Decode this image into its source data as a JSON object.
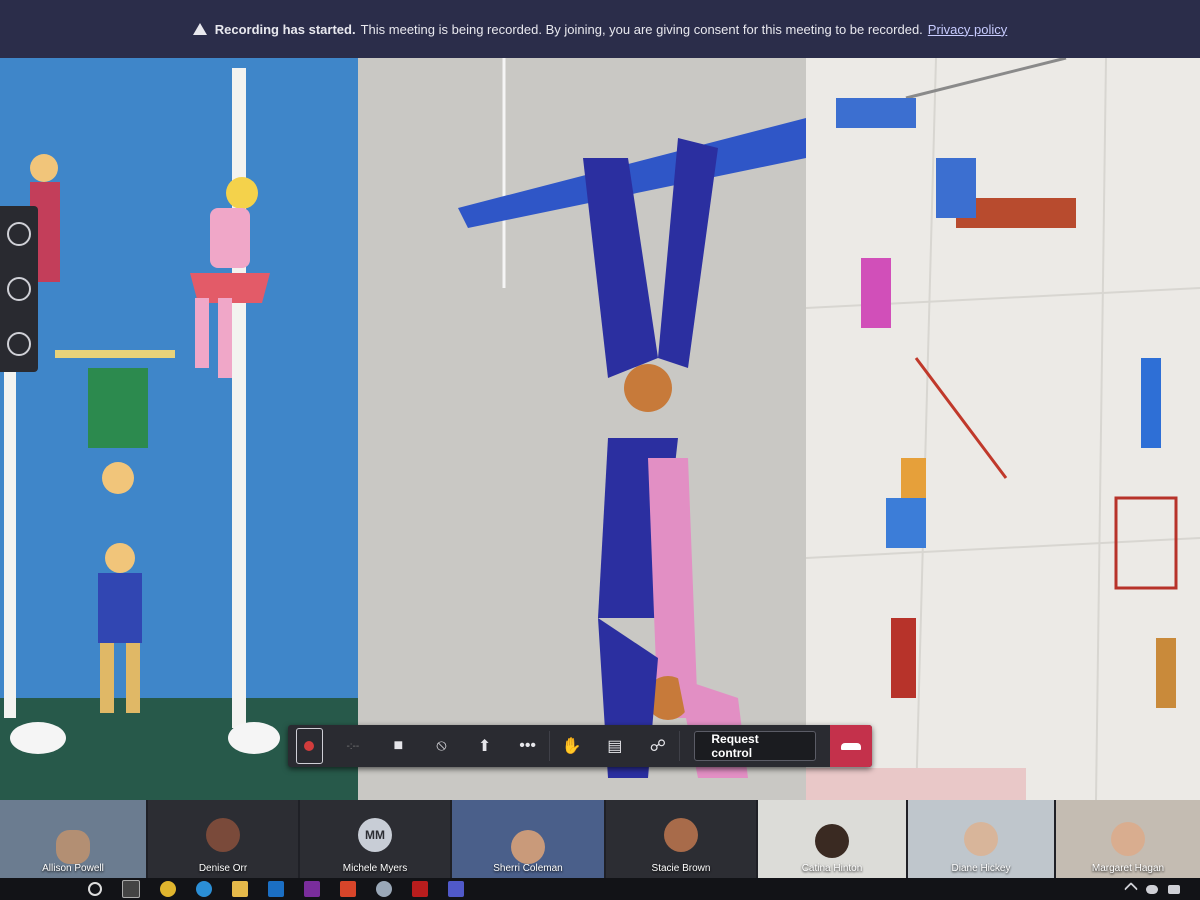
{
  "banner": {
    "title": "Recording has started.",
    "message": "This meeting is being recorded. By joining, you are giving consent for this meeting to be recorded.",
    "link": "Privacy policy"
  },
  "toolbar": {
    "request_control": "Request control"
  },
  "participants": [
    {
      "name": "Allison Powell"
    },
    {
      "name": "Denise Orr"
    },
    {
      "name": "Michele Myers",
      "initials": "MM"
    },
    {
      "name": "Sherri Coleman"
    },
    {
      "name": "Stacie Brown"
    },
    {
      "name": "Catina Hinton"
    },
    {
      "name": "Diane Hickey"
    },
    {
      "name": "Margaret Hagan"
    }
  ],
  "colors": {
    "banner_bg": "#2b2d4a",
    "toolbar_bg": "#2a2b31",
    "hangup": "#c4314b",
    "record_dot": "#d23c3c"
  }
}
